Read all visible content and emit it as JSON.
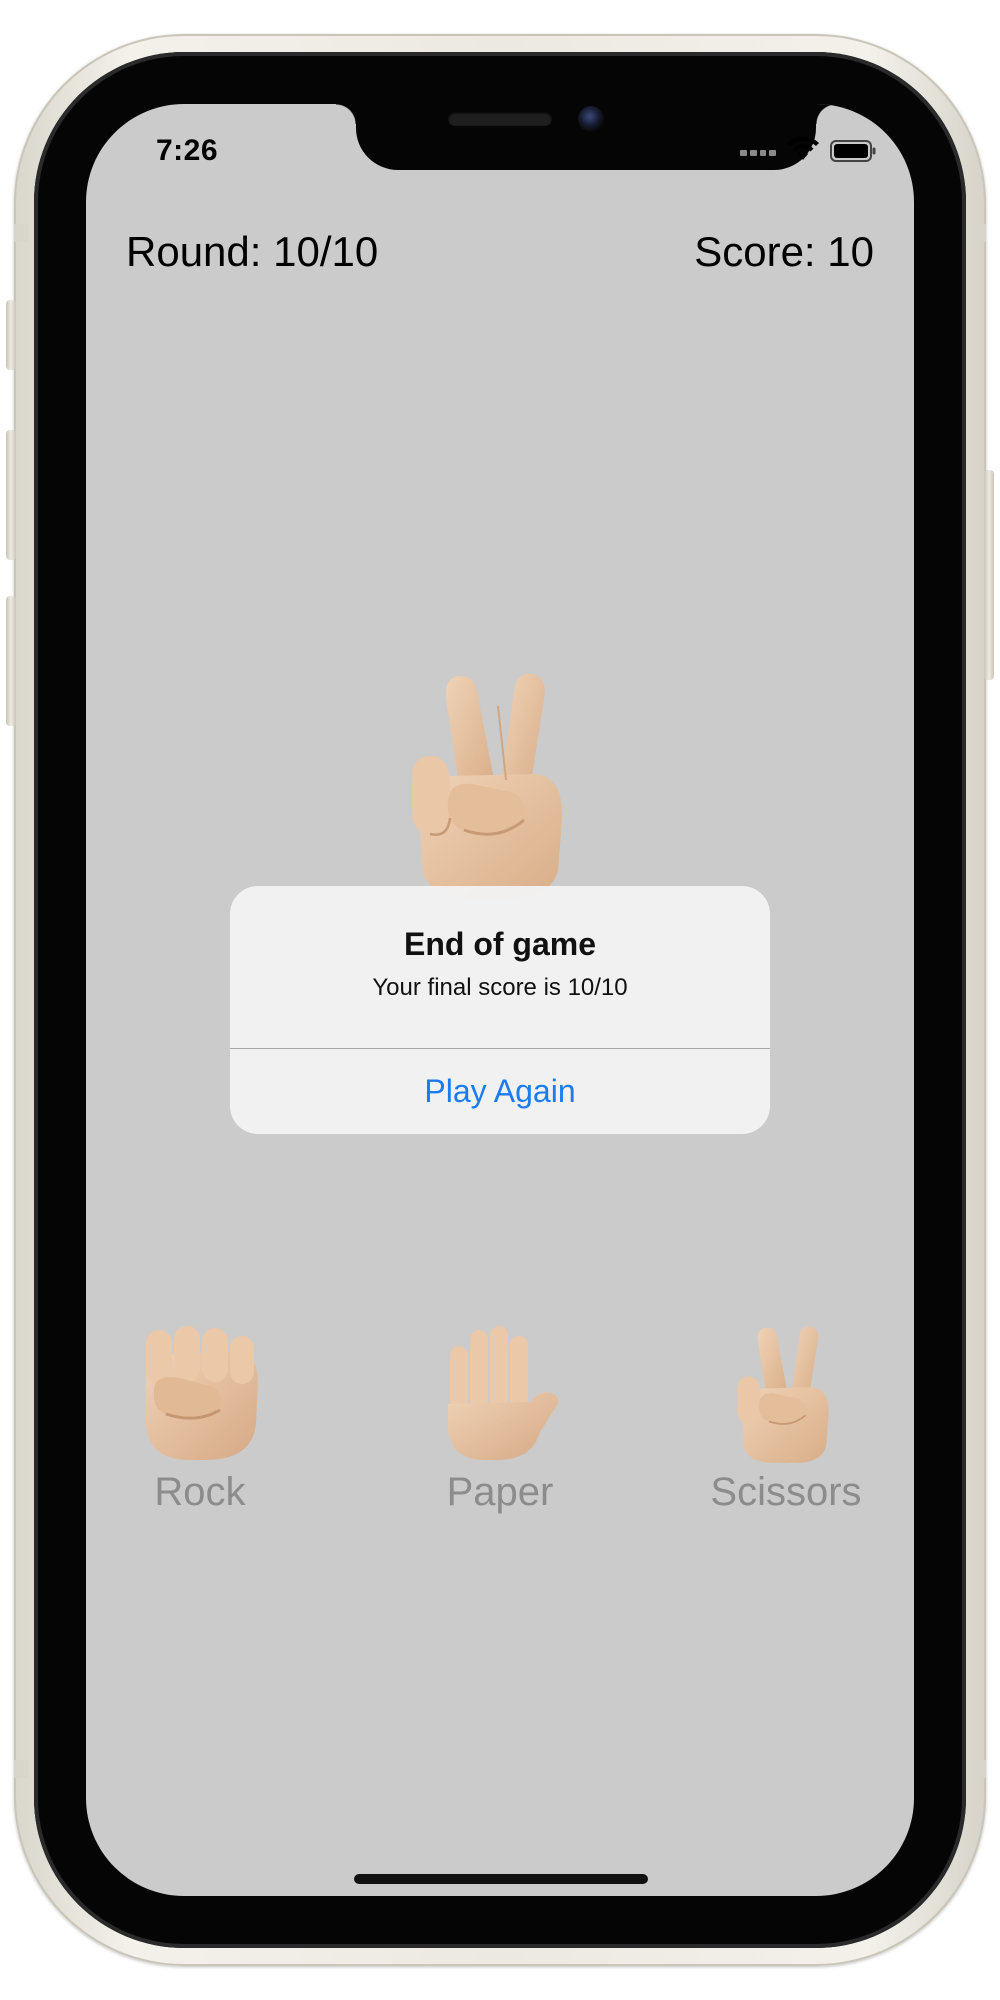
{
  "status_bar": {
    "time": "7:26",
    "icons": [
      "cellular-signal-icon",
      "wifi-icon",
      "battery-icon"
    ]
  },
  "header": {
    "round": "Round: 10/10",
    "score": "Score: 10"
  },
  "center": {
    "icon": "victory-hand-icon"
  },
  "choices": [
    {
      "label": "Rock",
      "icon": "raised-fist-icon"
    },
    {
      "label": "Paper",
      "icon": "raised-hand-icon"
    },
    {
      "label": "Scissors",
      "icon": "victory-hand-icon"
    }
  ],
  "alert": {
    "title": "End of game",
    "message": "Your final score is 10/10",
    "button_label": "Play Again"
  },
  "colors": {
    "screen_background": "#cbcbcb",
    "accent": "#1a7cf0",
    "choice_label": "#8c8c8c",
    "skin_tone": "#e7c3a2"
  }
}
